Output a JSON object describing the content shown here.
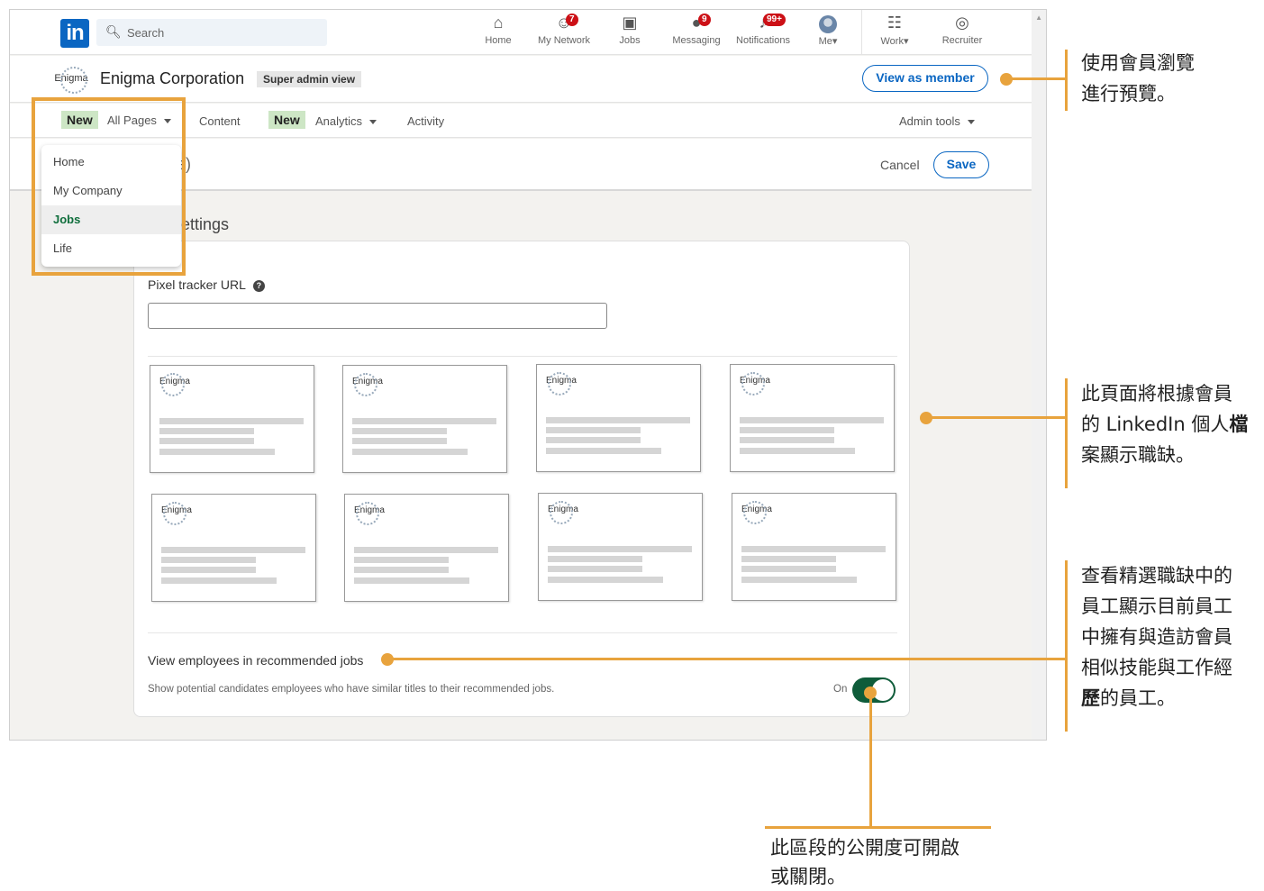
{
  "topnav": {
    "logo_text": "in",
    "search_placeholder": "Search",
    "items": [
      {
        "label": "Home",
        "icon": "home-icon"
      },
      {
        "label": "My Network",
        "icon": "network-icon",
        "badge": "7"
      },
      {
        "label": "Jobs",
        "icon": "briefcase-icon"
      },
      {
        "label": "Messaging",
        "icon": "messaging-icon",
        "badge": "9"
      },
      {
        "label": "Notifications",
        "icon": "bell-icon",
        "badge": "99+"
      },
      {
        "label": "Me",
        "icon": "avatar"
      },
      {
        "label": "Work",
        "icon": "grid-icon"
      },
      {
        "label": "Recruiter",
        "icon": "recruiter-icon"
      }
    ]
  },
  "org": {
    "logo_text": "Enigma",
    "name": "Enigma Corporation",
    "badge": "Super admin view",
    "view_as_member": "View as member"
  },
  "tabs": {
    "new_tag": "New",
    "all_pages": "All Pages",
    "content": "Content",
    "analytics": "Analytics",
    "activity": "Activity",
    "admin_tools": "Admin tools"
  },
  "dropdown": {
    "items": [
      "Home",
      "My Company",
      "Jobs",
      "Life"
    ],
    "active": "Jobs"
  },
  "editbar": {
    "title_fragment": "e)",
    "cancel": "Cancel",
    "save": "Save"
  },
  "settings": {
    "title_fragment": "ettings",
    "pixel_label": "Pixel tracker URL",
    "pixel_value": "",
    "help_glyph": "?",
    "thumb_logo": "Enigma",
    "employees_label": "View employees in recommended jobs",
    "employees_desc": "Show potential candidates employees who have similar titles to their recommended jobs.",
    "toggle_state": "On"
  },
  "callouts": {
    "preview": [
      "使用會員瀏覽",
      "進行預覽。"
    ],
    "jobs_display": [
      "此頁面將根據會員",
      "的 LinkedIn 個人",
      "檔",
      "案顯示職缺。"
    ],
    "employees": [
      "查看精選職缺中的",
      "員工顯示目前員工",
      "中擁有與造訪會員",
      "相似技能與工作經",
      "歷",
      "的員工。"
    ],
    "visibility": [
      "此區段的公開度可開啟",
      "或關閉。"
    ]
  },
  "colors": {
    "accent_callout": "#e8a33d",
    "linkedin_blue": "#0a66c2",
    "toggle_green": "#0f5c3a",
    "new_tag_green": "#cde6c5"
  }
}
